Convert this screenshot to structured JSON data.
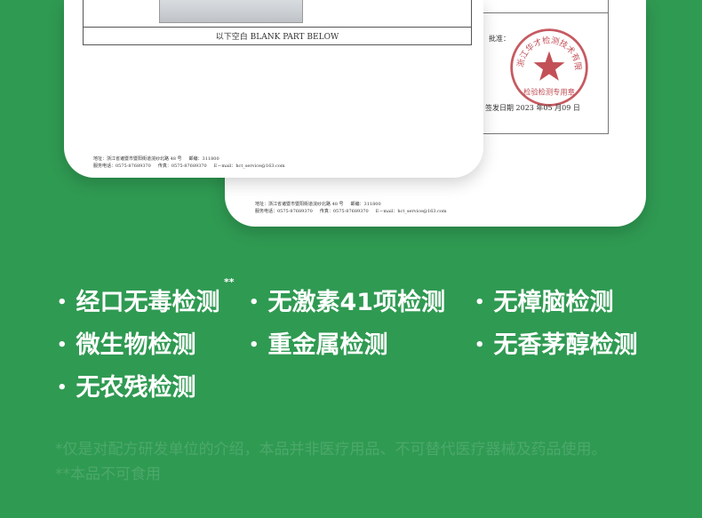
{
  "documents": {
    "front": {
      "blank_note": "以下空白 BLANK PART BELOW",
      "footer_line1": [
        "地址：浙江省诸暨市暨阳街道浣纱北路 48 号",
        "邮编：311800"
      ],
      "footer_line2": [
        "服务电话：0575-87689370",
        "传真：0575-87689370",
        "E－mail：hct_service@163.com"
      ]
    },
    "back": {
      "approve_label": "批准：",
      "issue_date": "签发日期  2023  年05  月09  日",
      "seal_top_text": "浙江华才检测技术有限公司",
      "seal_bottom_text": "检验检测专用章",
      "footer_line1": [
        "地址：浙江省诸暨市暨阳街道浣纱北路 48 号",
        "邮编：311800"
      ],
      "footer_line2": [
        "服务电话：0575-87689370",
        "传真：0575-87689370",
        "E－mail：hct_service@163.com"
      ]
    }
  },
  "features": [
    {
      "label": "经口无毒检测"
    },
    {
      "label": "无激素41项检测"
    },
    {
      "label": "无樟脑检测"
    },
    {
      "label": "微生物检测"
    },
    {
      "label": "重金属检测"
    },
    {
      "label": "无香茅醇检测"
    },
    {
      "label": "无农残检测"
    }
  ],
  "bullet": "•",
  "star_mark": "**",
  "disclaimer": {
    "line1": "*仅是对配方研发单位的介绍，本品并非医疗用品、不可替代医疗器械及药品使用。",
    "line2": "**本品不可食用"
  },
  "colors": {
    "background": "#2f9a52",
    "seal_red": "#b8313a"
  }
}
